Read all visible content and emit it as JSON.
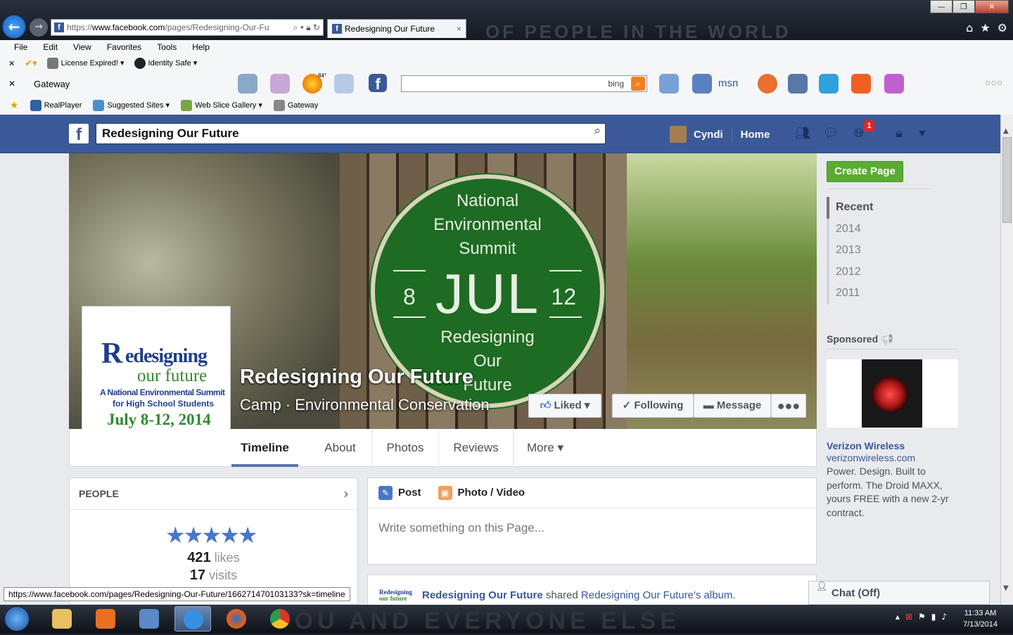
{
  "browser": {
    "address_prefix": "https://",
    "address_host": "www.facebook.com",
    "address_rest": "/pages/Redesigning-Our-Fu",
    "tab_title": "Redesigning Our Future",
    "menu": [
      "File",
      "Edit",
      "View",
      "Favorites",
      "Tools",
      "Help"
    ],
    "command_items": [
      "License Expired!",
      "Identity Safe"
    ],
    "toolbar_label": "Gateway",
    "weather_temp": "84°",
    "search_brand": "bing",
    "msn_label": "msn",
    "favorites": [
      "RealPlayer",
      "Suggested Sites",
      "Web Slice Gallery",
      "Gateway"
    ],
    "status_url": "https://www.facebook.com/pages/Redesigning-Our-Future/166271470103133?sk=timeline",
    "icons": [
      "back-arrow-icon",
      "forward-arrow-icon",
      "home-icon",
      "star-icon",
      "gear-icon"
    ]
  },
  "fb": {
    "search_value": "Redesigning Our Future",
    "user_name": "Cyndi",
    "home_label": "Home",
    "notification_count": "1"
  },
  "page": {
    "title": "Redesigning Our Future",
    "subtitle": "Camp · Environmental Conservation",
    "buttons": {
      "liked": "Liked",
      "following": "Following",
      "message": "Message"
    },
    "cover_badge": {
      "line1": "National",
      "line2": "Environmental",
      "line3": "Summit",
      "month": "JUL",
      "day_start": "8",
      "day_end": "12",
      "line4": "Redesigning",
      "line5": "Our",
      "line6": "Future"
    },
    "profile_logo": {
      "r": "R",
      "rest": "edesigning",
      "of": "our future",
      "tag1": "A National Environmental Summit",
      "tag2": "for High School Students",
      "date": "July 8-12, 2014"
    },
    "tabs": [
      "Timeline",
      "About",
      "Photos",
      "Reviews",
      "More ▾"
    ],
    "active_tab": "Timeline",
    "people": {
      "header": "PEOPLE",
      "rating_stars": 5,
      "likes_count": "421",
      "likes_label": "likes",
      "visits_count": "17",
      "visits_label": "visits"
    },
    "composer": {
      "post_label": "Post",
      "photo_label": "Photo / Video",
      "placeholder": "Write something on this Page..."
    },
    "story": {
      "actor": "Redesigning Our Future",
      "verb": "shared",
      "object": "Redesigning Our Future's album."
    }
  },
  "sidebar": {
    "create_page": "Create Page",
    "years": [
      "Recent",
      "2014",
      "2013",
      "2012",
      "2011"
    ],
    "sponsored_label": "Sponsored",
    "ad": {
      "title": "Verizon Wireless",
      "url": "verizonwireless.com",
      "text": "Power. Design. Built to perform. The Droid MAXX, yours FREE with a new 2-yr contract."
    },
    "chat": "Chat (Off)"
  },
  "taskbar": {
    "time": "11:33 AM",
    "date": "7/13/2014"
  },
  "colors": {
    "fb_blue": "#3b5998",
    "create_green": "#5aac34",
    "badge_green": "#1e6b23",
    "notif_red": "#e0262a"
  }
}
